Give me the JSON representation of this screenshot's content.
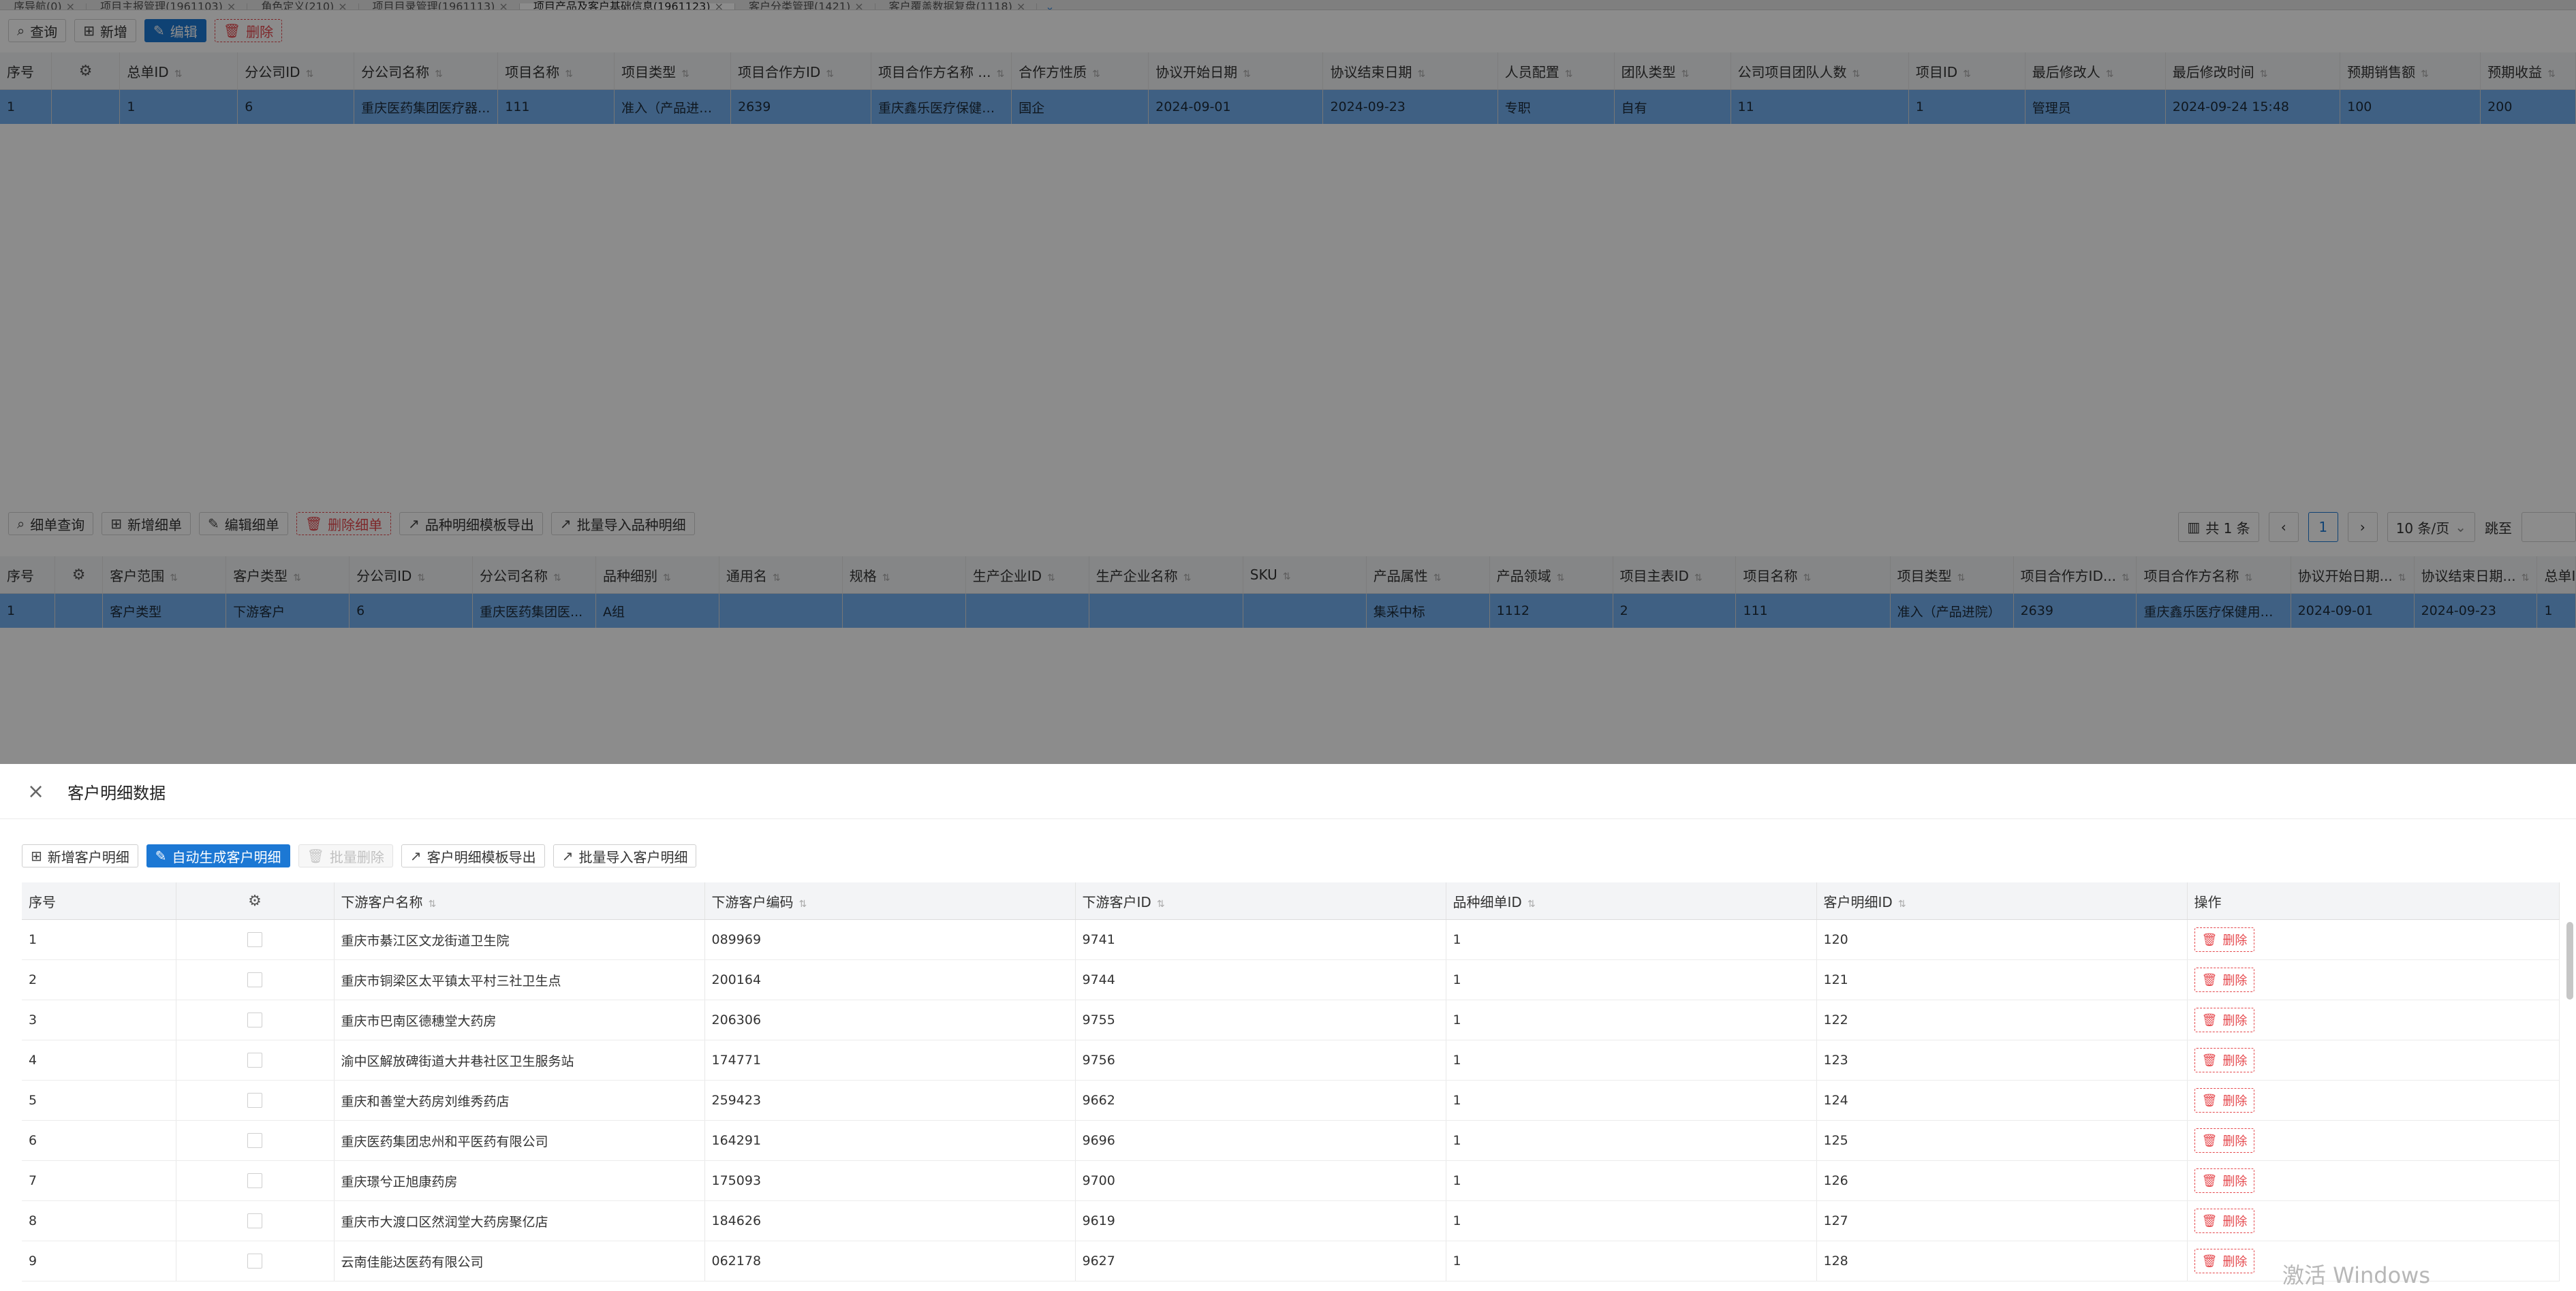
{
  "tabs": [
    {
      "label": "序导航(0)",
      "active": false
    },
    {
      "label": "项目主报管理(1961103)",
      "active": false
    },
    {
      "label": "角色定义(210)",
      "active": false
    },
    {
      "label": "项目目录管理(1961113)",
      "active": false
    },
    {
      "label": "项目产品及客户基础信息(1961123)",
      "active": true
    },
    {
      "label": "客户分类管理(1421)",
      "active": false
    },
    {
      "label": "客户覆盖数据复盘(1118)",
      "active": false
    }
  ],
  "tab_more": "⌄",
  "top_toolbar": {
    "query": "查询",
    "add": "新增",
    "edit": "编辑",
    "delete": "删除"
  },
  "top_table": {
    "headers": [
      "序号",
      "",
      "总单ID",
      "分公司ID",
      "分公司名称",
      "项目名称",
      "项目类型",
      "项目合作方ID",
      "项目合作方名称 ...",
      "合作方性质",
      "协议开始日期",
      "协议结束日期",
      "人员配置",
      "团队类型",
      "公司项目团队人数",
      "项目ID",
      "最后修改人",
      "最后修改时间",
      "预期销售额",
      "预期收益"
    ],
    "row": [
      "1",
      "",
      "1",
      "6",
      "重庆医药集团医疗器...",
      "111",
      "准入（产品进院）",
      "2639",
      "重庆鑫乐医疗保健用...",
      "国企",
      "2024-09-01",
      "2024-09-23",
      "专职",
      "自有",
      "11",
      "1",
      "管理员",
      "2024-09-24 15:48",
      "100",
      "200"
    ]
  },
  "sub_toolbar": {
    "query": "细单查询",
    "add": "新增细单",
    "edit": "编辑细单",
    "delete": "删除细单",
    "export": "品种明细模板导出",
    "import": "批量导入品种明细"
  },
  "pager": {
    "total": "共 1 条",
    "prev": "‹",
    "page": "1",
    "next": "›",
    "size": "10 条/页",
    "goto": "跳至"
  },
  "sub_table": {
    "headers": [
      "序号",
      "",
      "客户范围",
      "客户类型",
      "分公司ID",
      "分公司名称",
      "品种细别",
      "通用名",
      "规格",
      "生产企业ID",
      "生产企业名称",
      "SKU",
      "产品属性",
      "产品领域",
      "项目主表ID",
      "项目名称",
      "项目类型",
      "项目合作方ID...",
      "项目合作方名称",
      "协议开始日期...",
      "协议结束日期...",
      "总单ID"
    ],
    "row": [
      "1",
      "",
      "客户类型",
      "下游客户",
      "6",
      "重庆医药集团医...",
      "A组",
      "",
      "",
      "",
      "",
      "",
      "集采中标",
      "1112",
      "2",
      "111",
      "准入（产品进院）",
      "2639",
      "重庆鑫乐医疗保健用品...",
      "2024-09-01",
      "2024-09-23",
      "1"
    ]
  },
  "drawer": {
    "title": "客户明细数据",
    "toolbar": {
      "add": "新增客户明细",
      "auto": "自动生成客户明细",
      "batch_delete": "批量删除",
      "export": "客户明细模板导出",
      "import": "批量导入客户明细"
    },
    "headers": [
      "序号",
      "",
      "下游客户名称",
      "下游客户编码",
      "下游客户ID",
      "品种细单ID",
      "客户明细ID",
      "操作"
    ],
    "delete_label": "删除",
    "rows": [
      {
        "no": "1",
        "name": "重庆市綦江区文龙街道卫生院",
        "code": "089969",
        "cid": "9741",
        "did": "1",
        "mid": "120"
      },
      {
        "no": "2",
        "name": "重庆市铜梁区太平镇太平村三社卫生点",
        "code": "200164",
        "cid": "9744",
        "did": "1",
        "mid": "121"
      },
      {
        "no": "3",
        "name": "重庆市巴南区德穗堂大药房",
        "code": "206306",
        "cid": "9755",
        "did": "1",
        "mid": "122"
      },
      {
        "no": "4",
        "name": "渝中区解放碑街道大井巷社区卫生服务站",
        "code": "174771",
        "cid": "9756",
        "did": "1",
        "mid": "123"
      },
      {
        "no": "5",
        "name": "重庆和善堂大药房刘维秀药店",
        "code": "259423",
        "cid": "9662",
        "did": "1",
        "mid": "124"
      },
      {
        "no": "6",
        "name": "重庆医药集团忠州和平医药有限公司",
        "code": "164291",
        "cid": "9696",
        "did": "1",
        "mid": "125"
      },
      {
        "no": "7",
        "name": "重庆璟兮正旭康药房",
        "code": "175093",
        "cid": "9700",
        "did": "1",
        "mid": "126"
      },
      {
        "no": "8",
        "name": "重庆市大渡口区然润堂大药房聚亿店",
        "code": "184626",
        "cid": "9619",
        "did": "1",
        "mid": "127"
      },
      {
        "no": "9",
        "name": "云南佳能达医药有限公司",
        "code": "062178",
        "cid": "9627",
        "did": "1",
        "mid": "128"
      }
    ]
  },
  "watermark": "激活 Windows"
}
